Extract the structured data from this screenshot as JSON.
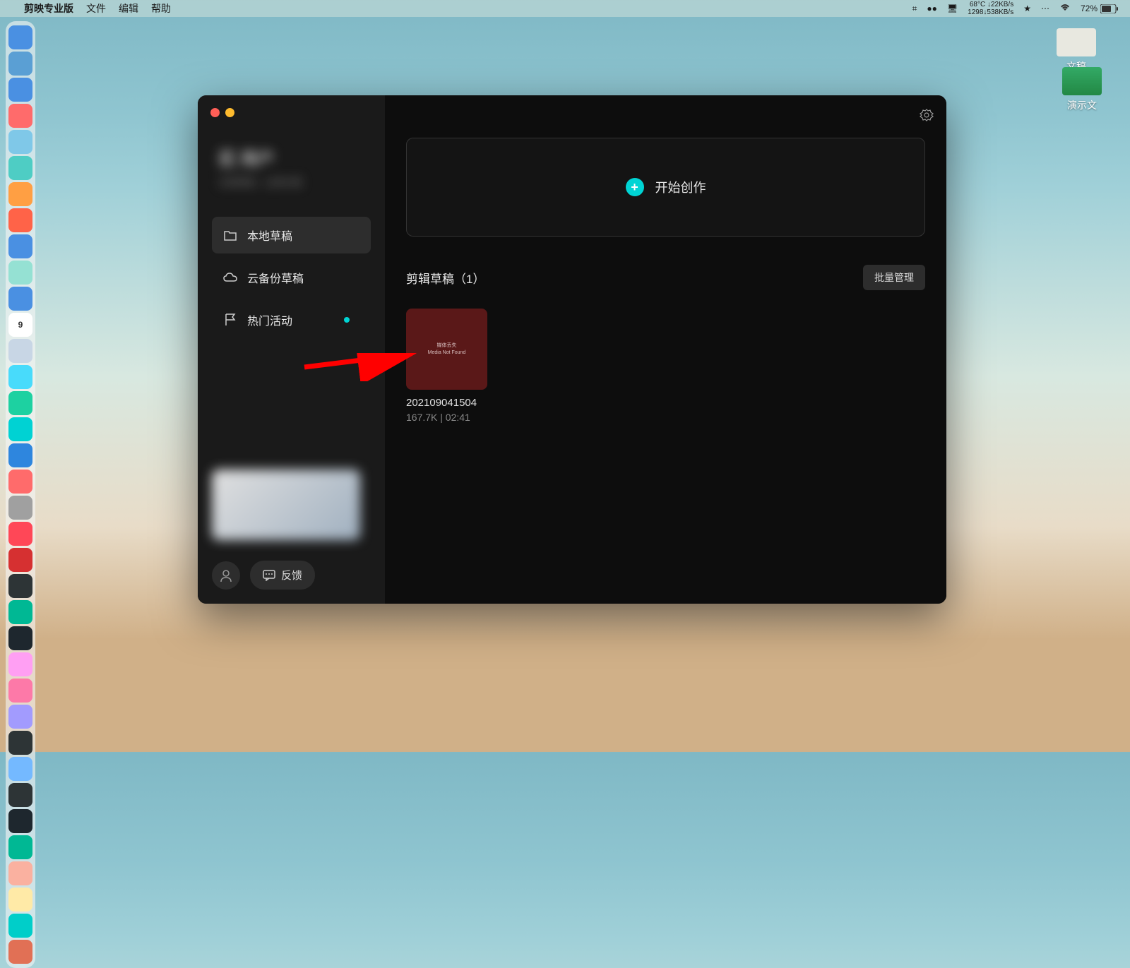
{
  "menubar": {
    "app_name": "剪映专业版",
    "items": [
      "文件",
      "编辑",
      "帮助"
    ],
    "temp": "68°C",
    "net_down": "↓22KB/s",
    "net_up": "1298↓538KB/s",
    "battery": "72%"
  },
  "desktop": {
    "doc_label": "文稿",
    "pres_label": "演示文"
  },
  "sidebar": {
    "profile_name": "区 用户",
    "profile_sub": "在剪映剪，主演大幕",
    "items": [
      {
        "label": "本地草稿",
        "icon": "folder"
      },
      {
        "label": "云备份草稿",
        "icon": "cloud"
      },
      {
        "label": "热门活动",
        "icon": "flag",
        "dot": true
      }
    ],
    "feedback": "反馈"
  },
  "main": {
    "create_label": "开始创作",
    "drafts_title": "剪辑草稿（1）",
    "batch_label": "批量管理",
    "draft": {
      "thumb_line1": "媒体丢失",
      "thumb_line2": "Media Not Found",
      "name": "202109041504",
      "size": "167.7K",
      "duration": "02:41"
    }
  },
  "dock_colors": [
    "#4a90e2",
    "#5a9fd4",
    "#4a90e2",
    "#ff6b6b",
    "#7fc8e8",
    "#4ecdc4",
    "#ff9f43",
    "#ff6348",
    "#4a90e2",
    "#95e1d3",
    "#4a90e2",
    "#ffffff",
    "#c8d6e5",
    "#48dbfb",
    "#1dd1a1",
    "#00d2d3",
    "#2e86de",
    "#ff6b6b",
    "#a0a0a0",
    "#ff4757",
    "#d63031",
    "#2d3436",
    "#00b894",
    "#1e272e",
    "#ff9ff3",
    "#fd79a8",
    "#a29bfe",
    "#2d3436",
    "#74b9ff",
    "#2d3436",
    "#1e272e",
    "#00b894",
    "#fab1a0",
    "#ffeaa7",
    "#00cec9",
    "#e17055"
  ]
}
